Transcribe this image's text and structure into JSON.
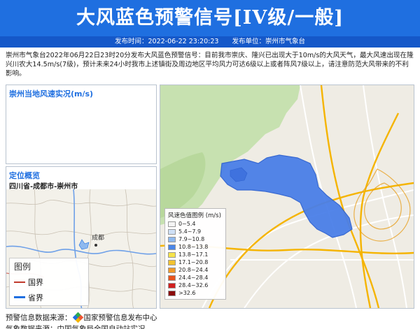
{
  "header": {
    "title": "大风蓝色预警信号[IV级/一般]",
    "publish_time_label": "发布时间：2022-06-22 23:20:23",
    "publisher_label": "发布单位：崇州市气象台"
  },
  "description": "崇州市气象台2022年06月22日23时20分发布大风蓝色预警信号：目前我市崇庆、隆兴已出现大于10m/s的大风天气，最大风速出现在隆兴川农大14.5m/s(7级)，预计未来24小时我市上述镇街及周边地区平均风力可达6级以上或者阵风7级以上，请注意防范大风带来的不利影响。",
  "panels": {
    "live_wind": {
      "title": "崇州当地风速实况(m/s)"
    },
    "location": {
      "title": "定位概览",
      "region": "四川省-成都市-崇州市",
      "city_label": "成都"
    }
  },
  "map_legend": {
    "title": "图例",
    "items": [
      {
        "label": "国界",
        "color": "#c0392b"
      },
      {
        "label": "省界",
        "color": "#1f6fe0"
      }
    ]
  },
  "wind_legend": {
    "title": "风速色值图例 (m/s)",
    "items": [
      {
        "label": "0~5.4",
        "color": "#f4f4f4"
      },
      {
        "label": "5.4~7.9",
        "color": "#cfe0f6"
      },
      {
        "label": "7.9~10.8",
        "color": "#8fb9ef"
      },
      {
        "label": "10.8~13.8",
        "color": "#4a86e8"
      },
      {
        "label": "13.8~17.1",
        "color": "#f6e34a"
      },
      {
        "label": "17.1~20.8",
        "color": "#f2c230"
      },
      {
        "label": "20.8~24.4",
        "color": "#f09a2a"
      },
      {
        "label": "24.4~28.4",
        "color": "#e8541e"
      },
      {
        "label": "28.4~32.6",
        "color": "#d11f1f"
      },
      {
        "label": ">32.6",
        "color": "#8b0b0b"
      }
    ]
  },
  "footer": {
    "source_prefix": "预警信息数据来源：",
    "source_name": "国家预警信息发布中心",
    "data_source": "气象数据来源：中国气象局全国自动站实况"
  }
}
